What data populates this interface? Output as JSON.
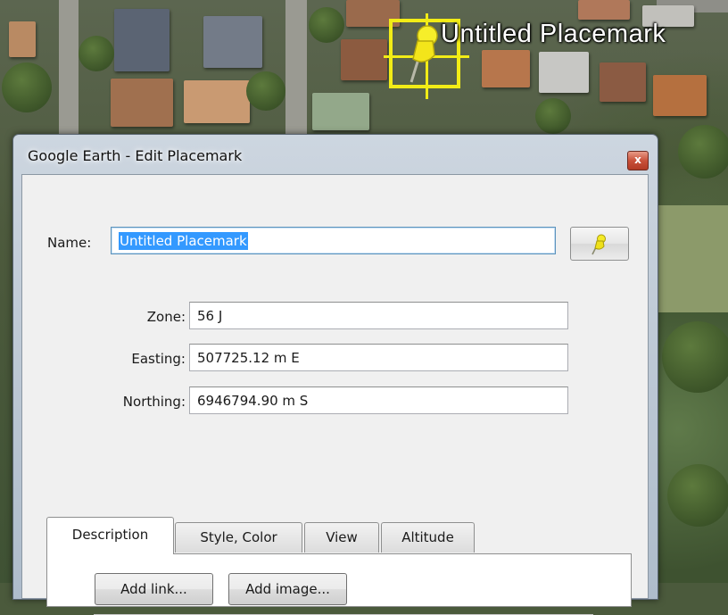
{
  "map": {
    "placemark_label": "Untitled Placemark",
    "icon": "pushpin-icon",
    "selection_color": "#f2ec16"
  },
  "dialog": {
    "title": "Google Earth - Edit Placemark",
    "close_glyph": "x",
    "name_label": "Name:",
    "name_value": "Untitled Placemark",
    "icon_button": "pushpin-icon",
    "zone_label": "Zone:",
    "zone_value": "56 J",
    "easting_label": "Easting:",
    "easting_value": "507725.12 m E",
    "northing_label": "Northing:",
    "northing_value": "6946794.90 m S",
    "tabs": [
      {
        "label": "Description",
        "active": true
      },
      {
        "label": "Style, Color",
        "active": false
      },
      {
        "label": "View",
        "active": false
      },
      {
        "label": "Altitude",
        "active": false
      }
    ],
    "add_link_label": "Add link...",
    "add_image_label": "Add image..."
  }
}
